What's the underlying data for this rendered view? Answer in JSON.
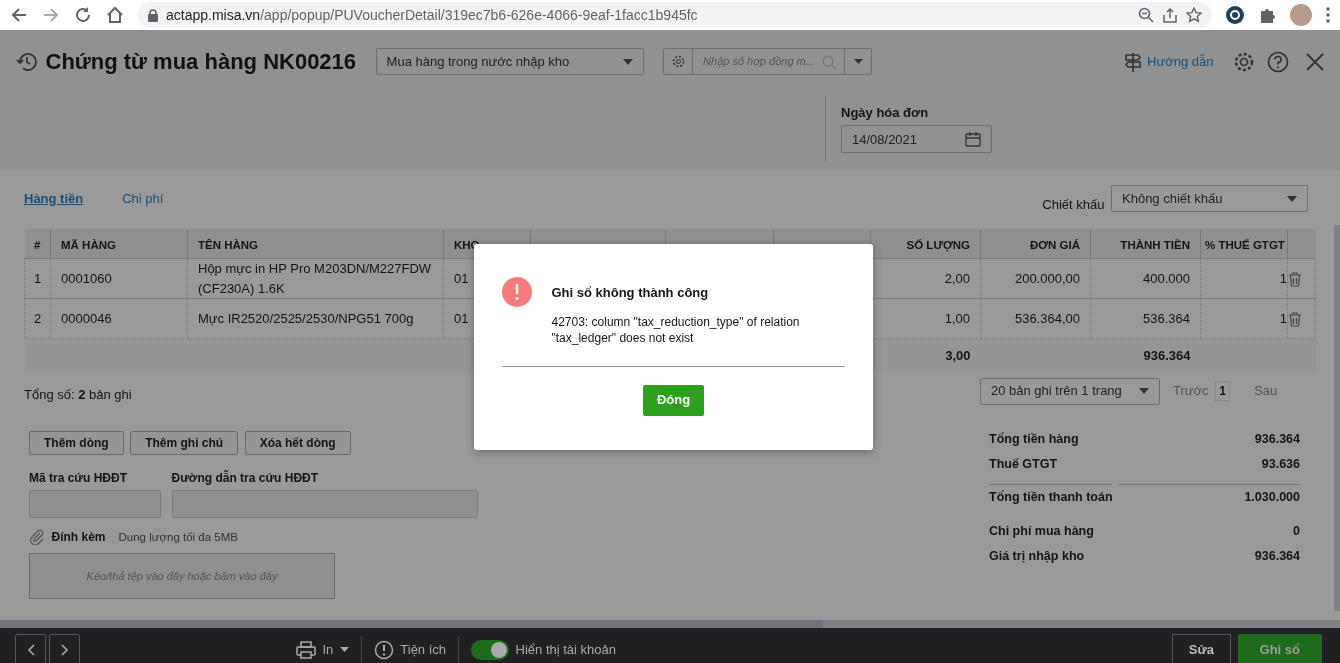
{
  "browser": {
    "host": "actapp.misa.vn",
    "path": "/app/popup/PUVoucherDetail/319ec7b6-626e-4066-9eaf-1facc1b945fc"
  },
  "header": {
    "title": "Chứng từ mua hàng NK00216",
    "voucher_type": "Mua hàng trong nước nhập kho",
    "contract_placeholder": "Nhập số hợp đồng m...",
    "guide_link": "Hướng dẫn"
  },
  "invoice_date": {
    "label": "Ngày hóa đơn",
    "value": "14/08/2021"
  },
  "tabs": [
    {
      "label": "Hàng tiền",
      "selected": true
    },
    {
      "label": "Chi phí",
      "selected": false
    }
  ],
  "discount": {
    "label": "Chiết khấu",
    "value": "Không chiết khấu"
  },
  "table": {
    "columns": [
      "#",
      "MÃ HÀNG",
      "TÊN HÀNG",
      "KHO",
      "SỐ LƯỢNG",
      "ĐƠN GIÁ",
      "THÀNH TIỀN",
      "% THUẾ GTGT"
    ],
    "rows": [
      {
        "no": "1",
        "code": "0001060",
        "name": "Hộp mực in HP Pro M203DN/M227FDW (CF230A) 1.6K",
        "warehouse": "01",
        "quantity": "2,00",
        "unit_price": "200.000,00",
        "amount": "400.000",
        "vat_rate": "1"
      },
      {
        "no": "2",
        "code": "0000046",
        "name": "Mực IR2520/2525/2530/NPG51 700g",
        "warehouse": "01",
        "quantity": "1,00",
        "unit_price": "536.364,00",
        "amount": "536.364",
        "vat_rate": "1"
      }
    ],
    "totals": {
      "quantity": "3,00",
      "amount": "936.364"
    }
  },
  "record_count": "Tổng số: **2** bản ghi",
  "pager": {
    "page_size": "20 bản ghi trên 1 trang",
    "prev": "Trước",
    "page": "1",
    "next": "Sau"
  },
  "row_buttons": [
    "Thêm dòng",
    "Thêm ghi chú",
    "Xóa hết dòng"
  ],
  "einvoice_fields": [
    {
      "label": "Mã tra cứu HĐĐT"
    },
    {
      "label": "Đường dẫn tra cứu HĐĐT"
    }
  ],
  "attachment": {
    "label": "Đính kèm",
    "hint": "Dung lượng tối đa 5MB",
    "drop_text": "Kéo/thả tệp vào đây hoặc bấm vào đây"
  },
  "summary": [
    {
      "label": "Tổng tiền hàng",
      "value": "936.364"
    },
    {
      "label": "Thuế GTGT",
      "value": "93.636"
    },
    {
      "label": "Tổng tiền thanh toán",
      "value": "1.030.000"
    },
    {
      "label": "Chi phí mua hàng",
      "value": "0"
    },
    {
      "label": "Giá trị nhập kho",
      "value": "936.364"
    }
  ],
  "footer": {
    "print": "In",
    "utilities": "Tiện ích",
    "show_accounts": {
      "label": "Hiển thị tài khoản",
      "on": true
    },
    "edit": "Sửa",
    "post": "Ghi sổ"
  },
  "dialog": {
    "title": "Ghi sổ không thành công",
    "message": "42703: column \"tax_reduction_type\" of relation \"tax_ledger\" does not exist",
    "button": "Đóng"
  }
}
